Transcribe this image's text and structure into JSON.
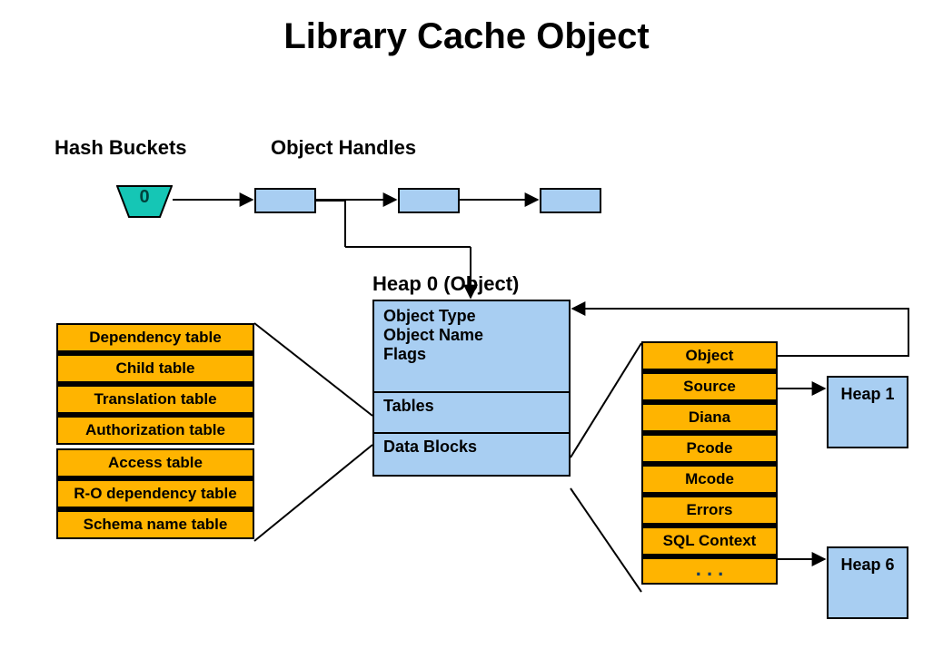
{
  "title": "Library Cache Object",
  "labels": {
    "hash_buckets": "Hash Buckets",
    "object_handles": "Object Handles",
    "heap0": "Heap 0 (Object)"
  },
  "bucket": {
    "number": "0"
  },
  "heap0_rows": {
    "r1_line1": "Object Type",
    "r1_line2": "Object Name",
    "r1_line3": "Flags",
    "r2": "Tables",
    "r3": "Data Blocks"
  },
  "left_tables": {
    "0": "Dependency table",
    "1": "Child table",
    "2": "Translation table",
    "3": "Authorization table",
    "4": "Access table",
    "5": "R-O dependency table",
    "6": "Schema name table"
  },
  "right_items": {
    "0": "Object",
    "1": "Source",
    "2": "Diana",
    "3": "Pcode",
    "4": "Mcode",
    "5": "Errors",
    "6": "SQL Context",
    "7": ". . ."
  },
  "heaps": {
    "h1": "Heap 1",
    "h6": "Heap 6"
  }
}
